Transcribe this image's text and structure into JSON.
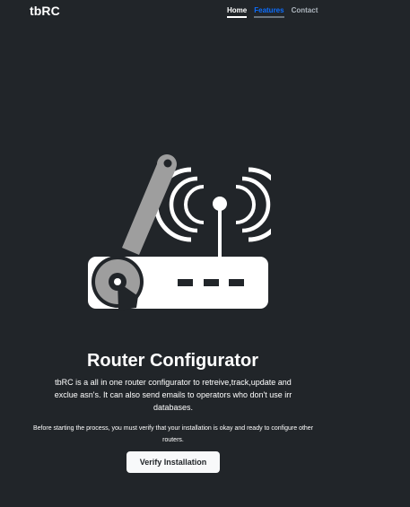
{
  "navbar": {
    "brand": "tbRC",
    "links": [
      {
        "label": "Home",
        "state": "active"
      },
      {
        "label": "Features",
        "state": "highlighted"
      },
      {
        "label": "Contact",
        "state": "default"
      }
    ]
  },
  "hero": {
    "icon": "router-wrench-icon",
    "title": "Router Configurator",
    "description": "tbRC is a all in one router configurator to retreive,track,update and exclue asn's. It can also send emails to operators who don't use irr databases.",
    "note": "Before starting the process, you must verify that your installation is okay and ready to configure other routers.",
    "button_label": "Verify Installation"
  },
  "colors": {
    "background": "#212529",
    "text": "#ffffff",
    "link_active": "#0d6efd",
    "link_muted": "#adb5bd",
    "button_bg": "#f8f9fa",
    "icon_grey": "#9e9e9e"
  }
}
